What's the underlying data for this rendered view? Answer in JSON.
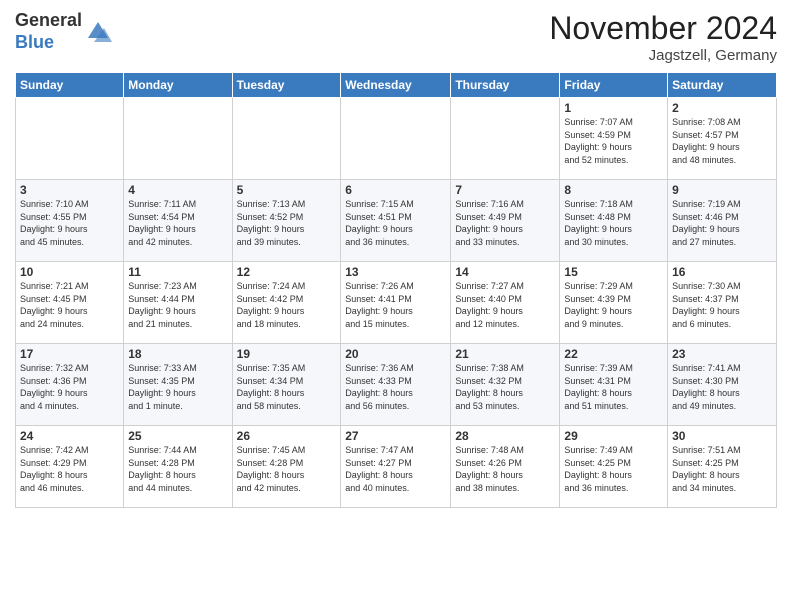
{
  "logo": {
    "line1": "General",
    "line2": "Blue"
  },
  "title": "November 2024",
  "location": "Jagstzell, Germany",
  "days_of_week": [
    "Sunday",
    "Monday",
    "Tuesday",
    "Wednesday",
    "Thursday",
    "Friday",
    "Saturday"
  ],
  "weeks": [
    [
      {
        "day": "",
        "info": ""
      },
      {
        "day": "",
        "info": ""
      },
      {
        "day": "",
        "info": ""
      },
      {
        "day": "",
        "info": ""
      },
      {
        "day": "",
        "info": ""
      },
      {
        "day": "1",
        "info": "Sunrise: 7:07 AM\nSunset: 4:59 PM\nDaylight: 9 hours\nand 52 minutes."
      },
      {
        "day": "2",
        "info": "Sunrise: 7:08 AM\nSunset: 4:57 PM\nDaylight: 9 hours\nand 48 minutes."
      }
    ],
    [
      {
        "day": "3",
        "info": "Sunrise: 7:10 AM\nSunset: 4:55 PM\nDaylight: 9 hours\nand 45 minutes."
      },
      {
        "day": "4",
        "info": "Sunrise: 7:11 AM\nSunset: 4:54 PM\nDaylight: 9 hours\nand 42 minutes."
      },
      {
        "day": "5",
        "info": "Sunrise: 7:13 AM\nSunset: 4:52 PM\nDaylight: 9 hours\nand 39 minutes."
      },
      {
        "day": "6",
        "info": "Sunrise: 7:15 AM\nSunset: 4:51 PM\nDaylight: 9 hours\nand 36 minutes."
      },
      {
        "day": "7",
        "info": "Sunrise: 7:16 AM\nSunset: 4:49 PM\nDaylight: 9 hours\nand 33 minutes."
      },
      {
        "day": "8",
        "info": "Sunrise: 7:18 AM\nSunset: 4:48 PM\nDaylight: 9 hours\nand 30 minutes."
      },
      {
        "day": "9",
        "info": "Sunrise: 7:19 AM\nSunset: 4:46 PM\nDaylight: 9 hours\nand 27 minutes."
      }
    ],
    [
      {
        "day": "10",
        "info": "Sunrise: 7:21 AM\nSunset: 4:45 PM\nDaylight: 9 hours\nand 24 minutes."
      },
      {
        "day": "11",
        "info": "Sunrise: 7:23 AM\nSunset: 4:44 PM\nDaylight: 9 hours\nand 21 minutes."
      },
      {
        "day": "12",
        "info": "Sunrise: 7:24 AM\nSunset: 4:42 PM\nDaylight: 9 hours\nand 18 minutes."
      },
      {
        "day": "13",
        "info": "Sunrise: 7:26 AM\nSunset: 4:41 PM\nDaylight: 9 hours\nand 15 minutes."
      },
      {
        "day": "14",
        "info": "Sunrise: 7:27 AM\nSunset: 4:40 PM\nDaylight: 9 hours\nand 12 minutes."
      },
      {
        "day": "15",
        "info": "Sunrise: 7:29 AM\nSunset: 4:39 PM\nDaylight: 9 hours\nand 9 minutes."
      },
      {
        "day": "16",
        "info": "Sunrise: 7:30 AM\nSunset: 4:37 PM\nDaylight: 9 hours\nand 6 minutes."
      }
    ],
    [
      {
        "day": "17",
        "info": "Sunrise: 7:32 AM\nSunset: 4:36 PM\nDaylight: 9 hours\nand 4 minutes."
      },
      {
        "day": "18",
        "info": "Sunrise: 7:33 AM\nSunset: 4:35 PM\nDaylight: 9 hours\nand 1 minute."
      },
      {
        "day": "19",
        "info": "Sunrise: 7:35 AM\nSunset: 4:34 PM\nDaylight: 8 hours\nand 58 minutes."
      },
      {
        "day": "20",
        "info": "Sunrise: 7:36 AM\nSunset: 4:33 PM\nDaylight: 8 hours\nand 56 minutes."
      },
      {
        "day": "21",
        "info": "Sunrise: 7:38 AM\nSunset: 4:32 PM\nDaylight: 8 hours\nand 53 minutes."
      },
      {
        "day": "22",
        "info": "Sunrise: 7:39 AM\nSunset: 4:31 PM\nDaylight: 8 hours\nand 51 minutes."
      },
      {
        "day": "23",
        "info": "Sunrise: 7:41 AM\nSunset: 4:30 PM\nDaylight: 8 hours\nand 49 minutes."
      }
    ],
    [
      {
        "day": "24",
        "info": "Sunrise: 7:42 AM\nSunset: 4:29 PM\nDaylight: 8 hours\nand 46 minutes."
      },
      {
        "day": "25",
        "info": "Sunrise: 7:44 AM\nSunset: 4:28 PM\nDaylight: 8 hours\nand 44 minutes."
      },
      {
        "day": "26",
        "info": "Sunrise: 7:45 AM\nSunset: 4:28 PM\nDaylight: 8 hours\nand 42 minutes."
      },
      {
        "day": "27",
        "info": "Sunrise: 7:47 AM\nSunset: 4:27 PM\nDaylight: 8 hours\nand 40 minutes."
      },
      {
        "day": "28",
        "info": "Sunrise: 7:48 AM\nSunset: 4:26 PM\nDaylight: 8 hours\nand 38 minutes."
      },
      {
        "day": "29",
        "info": "Sunrise: 7:49 AM\nSunset: 4:25 PM\nDaylight: 8 hours\nand 36 minutes."
      },
      {
        "day": "30",
        "info": "Sunrise: 7:51 AM\nSunset: 4:25 PM\nDaylight: 8 hours\nand 34 minutes."
      }
    ]
  ]
}
